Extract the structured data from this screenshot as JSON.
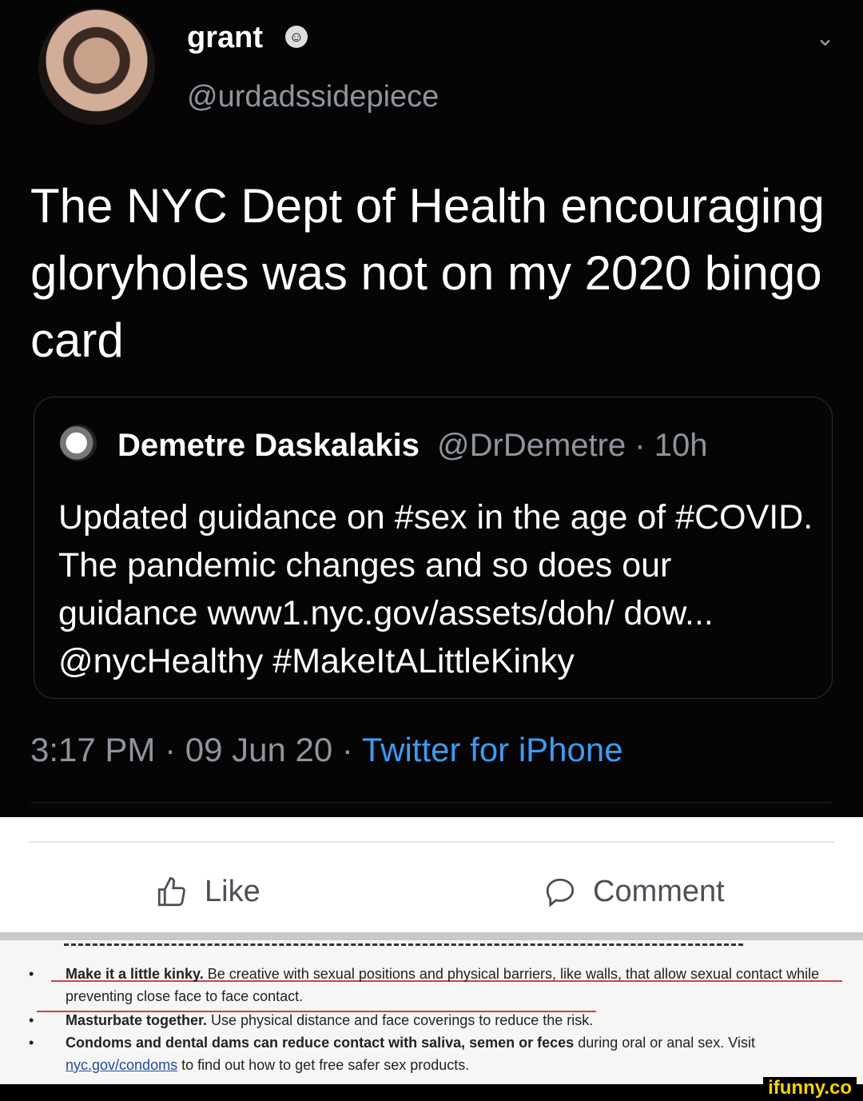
{
  "tweet": {
    "display_name": "grant",
    "name_emoji": "☺",
    "handle": "@urdadssidepiece",
    "menu_icon": "chevron-down-icon",
    "text": "The NYC Dept of Health encouraging gloryholes was not on my 2020 bingo card",
    "quote": {
      "display_name": "Demetre Daskalakis",
      "handle_time": "@DrDemetre · 10h",
      "text": "Updated guidance on #sex in the age of #COVID. The pandemic changes and so does our guidance www1.nyc.gov/assets/doh/ dow... @nycHealthy #MakeItALittleKinky"
    },
    "timestamp": "3:17 PM · 09 Jun 20 · ",
    "source": "Twitter for iPhone"
  },
  "facebook": {
    "like_label": "Like",
    "comment_label": "Comment"
  },
  "document": {
    "bullet1_bold": "Make it a little kinky.",
    "bullet1_rest": " Be creative with sexual positions and physical barriers, like walls, that allow sexual contact while preventing close face to face contact.",
    "bullet2_bold": "Masturbate together.",
    "bullet2_rest": " Use physical distance and face coverings to reduce the risk.",
    "bullet3_bold": "Condoms and dental dams can reduce contact with saliva, semen or feces",
    "bullet3_rest": " during oral or anal sex. Visit ",
    "bullet3_link": "nyc.gov/condoms",
    "bullet3_end": " to find out how to get free safer sex products."
  },
  "watermark": "ifunny.co"
}
